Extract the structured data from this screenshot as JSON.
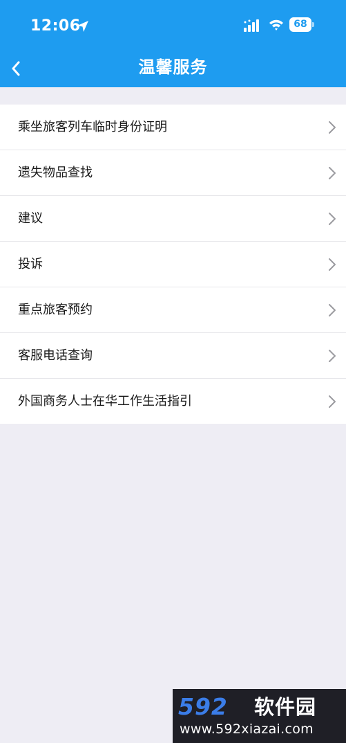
{
  "status_bar": {
    "time": "12:06",
    "battery_level": "68"
  },
  "header": {
    "title": "温馨服务"
  },
  "menu": {
    "items": [
      {
        "label": "乘坐旅客列车临时身份证明"
      },
      {
        "label": "遗失物品查找"
      },
      {
        "label": "建议"
      },
      {
        "label": "投诉"
      },
      {
        "label": "重点旅客预约"
      },
      {
        "label": "客服电话查询"
      },
      {
        "label": "外国商务人士在华工作生活指引"
      }
    ]
  },
  "watermark": {
    "logo_number": "592",
    "logo_text": "软件园",
    "url": "www.592xiazai.com"
  },
  "colors": {
    "header_bg": "#1e9cf0",
    "page_bg": "#eeedf4",
    "list_bg": "#ffffff",
    "chevron": "#9b9ba0"
  }
}
